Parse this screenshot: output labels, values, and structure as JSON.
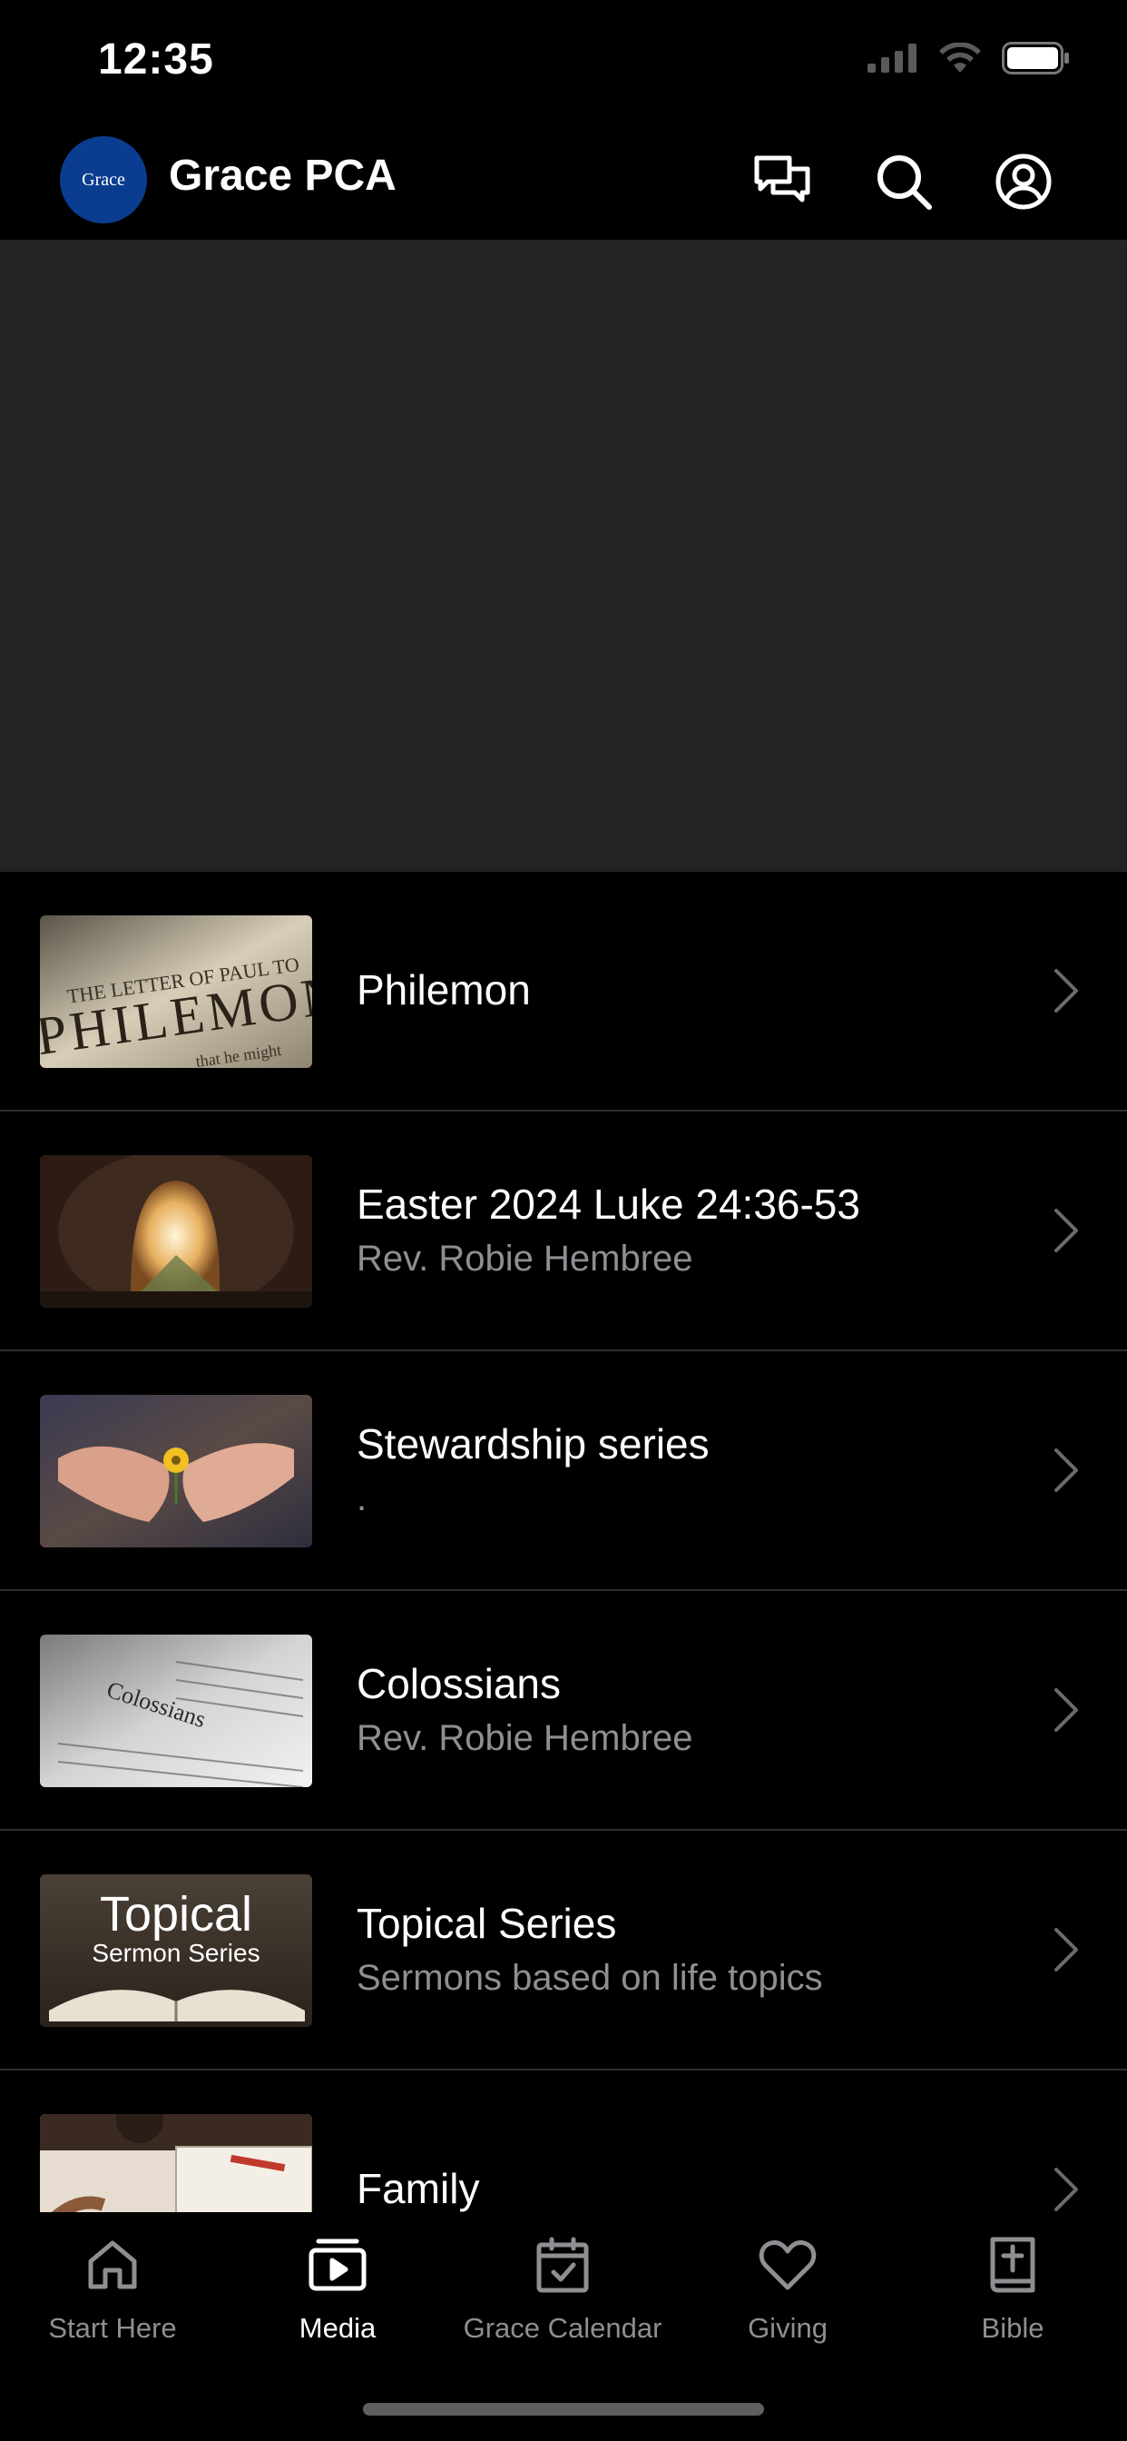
{
  "status_bar": {
    "time": "12:35",
    "icons": [
      "cellular-signal-icon",
      "wifi-icon",
      "battery-icon"
    ]
  },
  "header": {
    "logo_text": "Grace",
    "title": "Grace PCA",
    "actions": [
      "chat-icon",
      "search-icon",
      "profile-icon"
    ]
  },
  "list": {
    "items": [
      {
        "title": "Philemon",
        "subtitle": "",
        "thumbnail": "philemon-thumbnail"
      },
      {
        "title": "Easter 2024 Luke 24:36-53",
        "subtitle": "Rev. Robie Hembree",
        "thumbnail": "easter-tomb-thumbnail"
      },
      {
        "title": "Stewardship series",
        "subtitle": ".",
        "thumbnail": "stewardship-hands-thumbnail"
      },
      {
        "title": "Colossians",
        "subtitle": "Rev. Robie Hembree",
        "thumbnail": "colossians-bible-thumbnail"
      },
      {
        "title": "Topical Series",
        "subtitle": "Sermons based on life topics",
        "thumbnail": "topical-series-thumbnail",
        "thumbnail_text": [
          "Topical",
          "Sermon Series"
        ]
      },
      {
        "title": "Family",
        "subtitle": "",
        "thumbnail": "family-thumbnail"
      }
    ]
  },
  "tab_bar": {
    "tabs": [
      {
        "label": "Start Here",
        "icon": "home-icon",
        "active": false
      },
      {
        "label": "Media",
        "icon": "media-play-icon",
        "active": true
      },
      {
        "label": "Grace Calendar",
        "icon": "calendar-icon",
        "active": false
      },
      {
        "label": "Giving",
        "icon": "heart-icon",
        "active": false
      },
      {
        "label": "Bible",
        "icon": "bible-icon",
        "active": false
      }
    ]
  },
  "colors": {
    "background": "#000000",
    "hero_placeholder": "#232323",
    "secondary_text": "#8e8e93",
    "logo_blue": "#0a3d8f"
  }
}
